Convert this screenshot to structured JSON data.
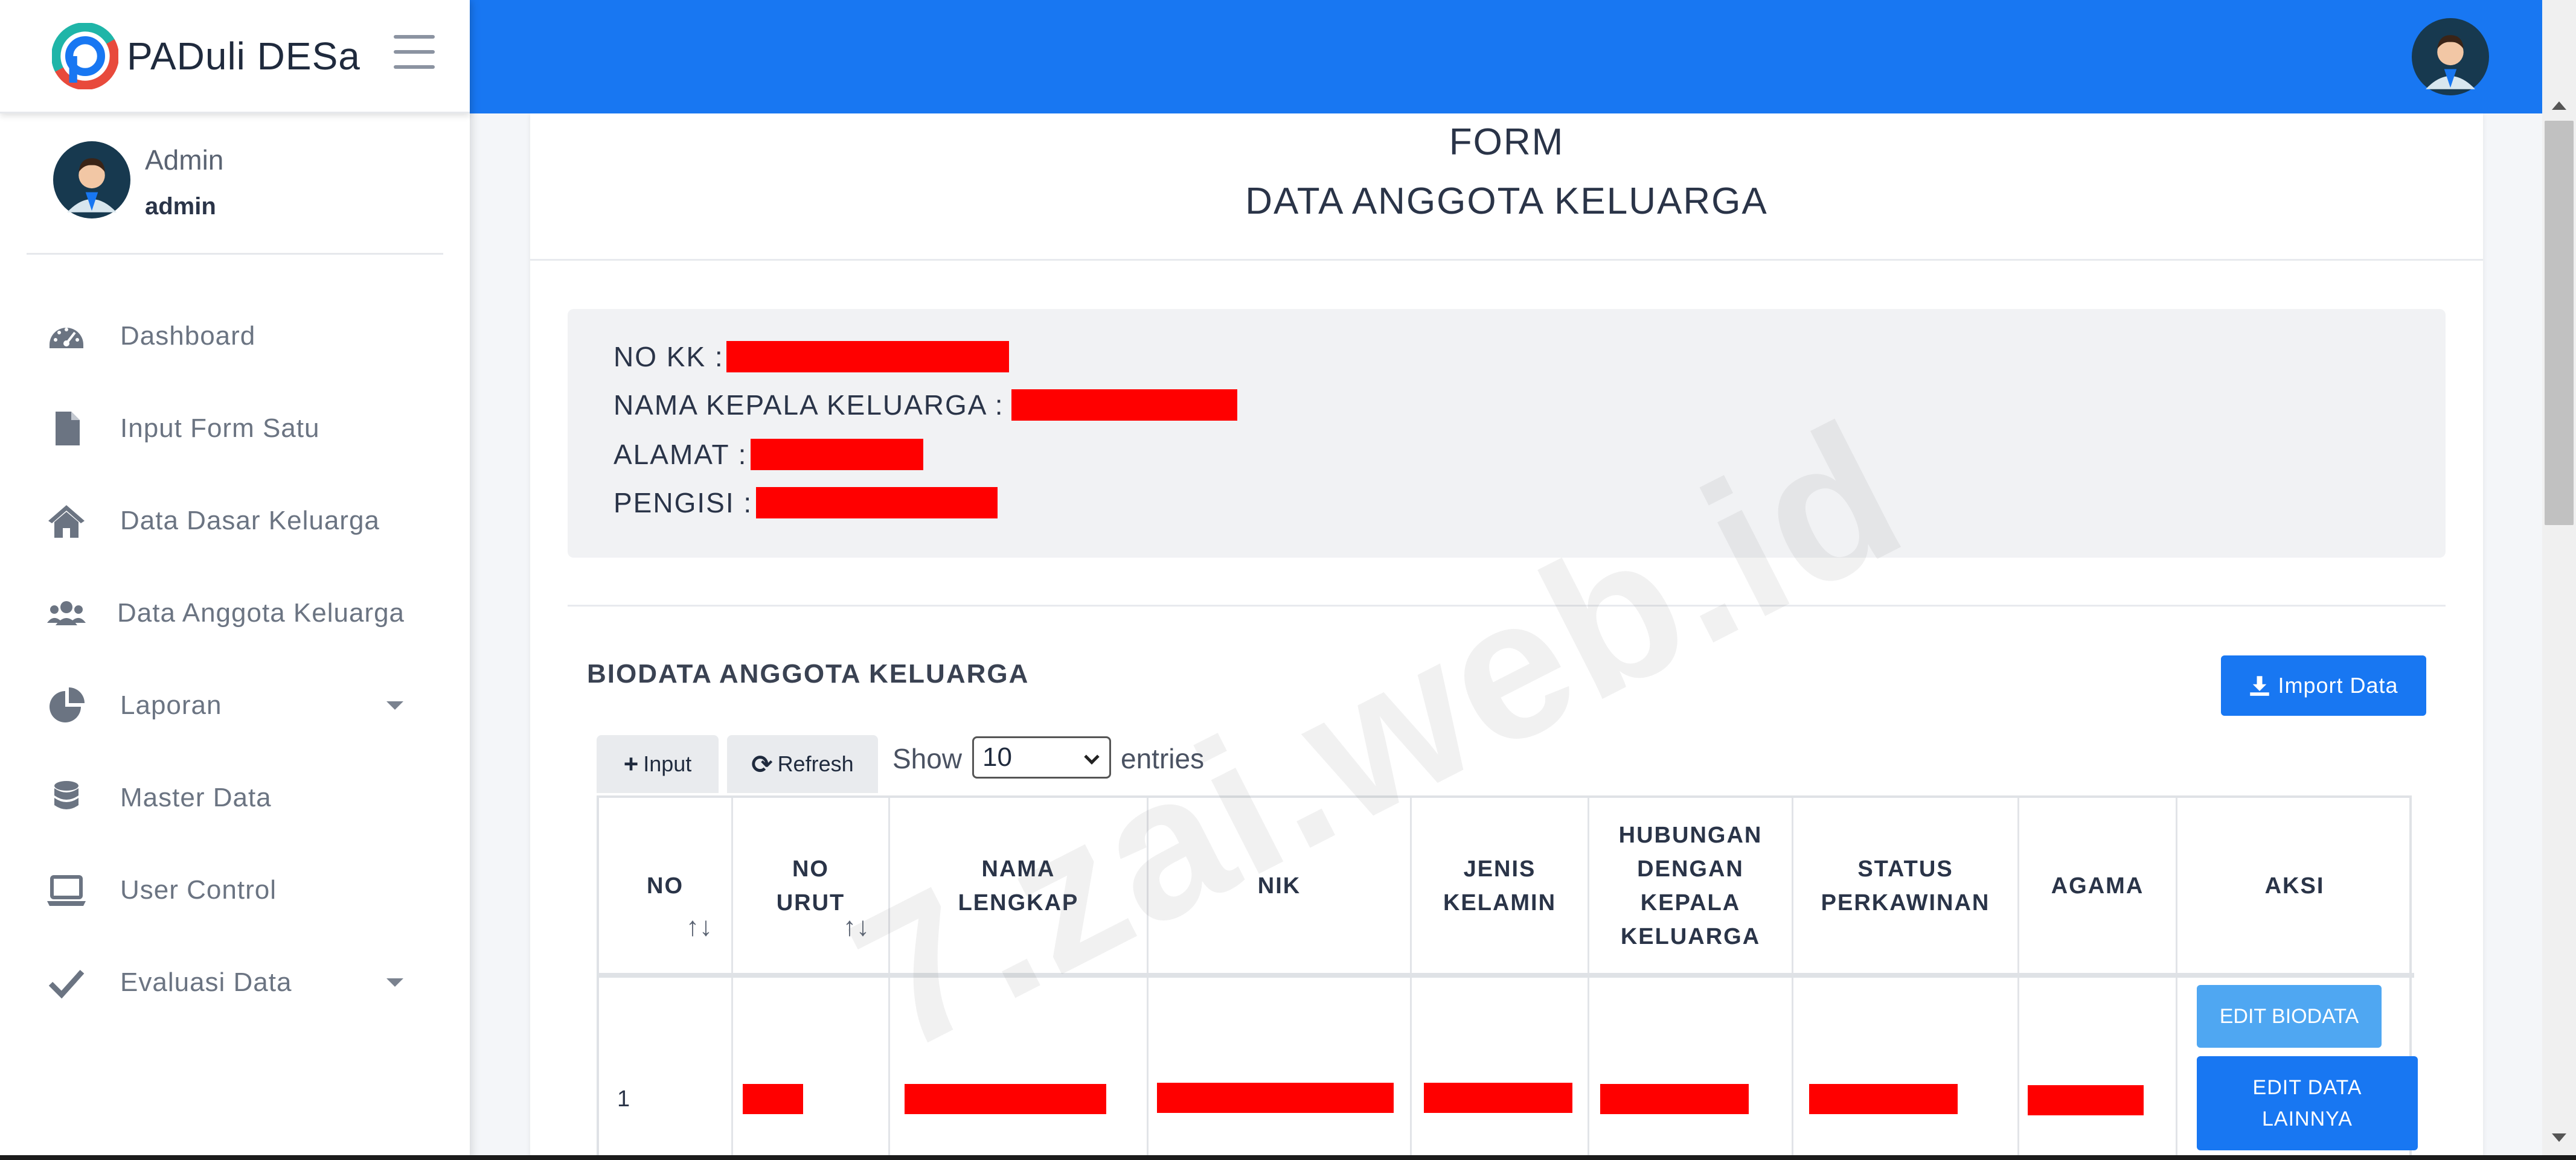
{
  "brand": {
    "name": "PADuli DESa"
  },
  "user": {
    "name": "Admin",
    "role": "admin"
  },
  "nav": {
    "items": [
      {
        "label": "Dashboard",
        "icon": "gauge-icon"
      },
      {
        "label": "Input Form Satu",
        "icon": "file-icon"
      },
      {
        "label": "Data Dasar Keluarga",
        "icon": "home-icon"
      },
      {
        "label": "Data Anggota Keluarga",
        "icon": "users-icon"
      },
      {
        "label": "Laporan",
        "icon": "pie-chart-icon",
        "dropdown": true
      },
      {
        "label": "Master Data",
        "icon": "database-icon"
      },
      {
        "label": "User Control",
        "icon": "laptop-icon"
      },
      {
        "label": "Evaluasi Data",
        "icon": "check-icon",
        "dropdown": true
      }
    ]
  },
  "form": {
    "title": "FORM",
    "subtitle": "DATA ANGGOTA KELUARGA",
    "info": {
      "no_kk": "NO KK :",
      "nama_kepala": "NAMA KEPALA KELUARGA :",
      "alamat": "ALAMAT :",
      "pengisi": "PENGISI :"
    }
  },
  "section": {
    "title": "BIODATA ANGGOTA KELUARGA",
    "import_label": "Import Data",
    "input_label": "Input",
    "refresh_label": "Refresh",
    "show_label": "Show",
    "entries_value": "10",
    "entries_label": "entries"
  },
  "table": {
    "headers": {
      "no": "NO",
      "no_urut_1": "NO",
      "no_urut_2": "URUT",
      "nama_1": "NAMA",
      "nama_2": "LENGKAP",
      "nik": "NIK",
      "jenis_1": "JENIS",
      "jenis_2": "KELAMIN",
      "hub_1": "HUBUNGAN",
      "hub_2": "DENGAN",
      "hub_3": "KEPALA",
      "hub_4": "KELUARGA",
      "status_1": "STATUS",
      "status_2": "PERKAWINAN",
      "agama": "AGAMA",
      "aksi": "AKSI"
    },
    "sort_glyph": "↑↓",
    "rows": [
      {
        "no": "1"
      }
    ],
    "actions": {
      "edit_biodata": "EDIT BIODATA",
      "edit_lain_1": "EDIT DATA",
      "edit_lain_2": "LAINNYA"
    }
  },
  "watermark": "7.zai.web.id",
  "colors": {
    "primary": "#1877f2",
    "light_primary": "#4fa7f2",
    "redaction": "#ff0000"
  }
}
